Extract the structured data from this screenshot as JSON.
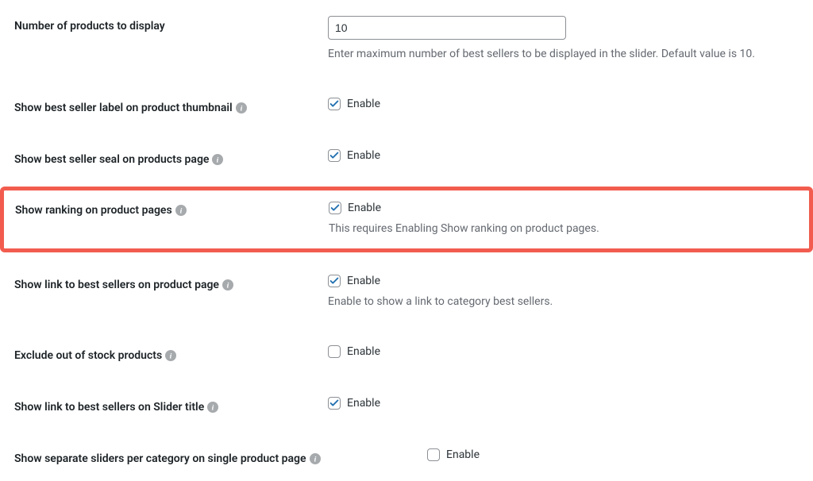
{
  "settings": {
    "numProducts": {
      "label": "Number of products to display",
      "value": "10",
      "description": "Enter maximum number of best sellers to be displayed in the slider. Default value is 10."
    },
    "labelThumbnail": {
      "label": "Show best seller label on product thumbnail",
      "checkboxLabel": "Enable",
      "checked": true
    },
    "sealProductsPage": {
      "label": "Show best seller seal on products page",
      "checkboxLabel": "Enable",
      "checked": true
    },
    "rankingProductPages": {
      "label": "Show ranking on product pages",
      "checkboxLabel": "Enable",
      "checked": true,
      "description": "This requires Enabling Show ranking on product pages."
    },
    "linkProductPage": {
      "label": "Show link to best sellers on product page",
      "checkboxLabel": "Enable",
      "checked": true,
      "description": "Enable to show a link to category best sellers."
    },
    "excludeOutOfStock": {
      "label": "Exclude out of stock products",
      "checkboxLabel": "Enable",
      "checked": false
    },
    "linkSliderTitle": {
      "label": "Show link to best sellers on Slider title",
      "checkboxLabel": "Enable",
      "checked": true
    },
    "separateSliders": {
      "label": "Show separate sliders per category on single product page",
      "checkboxLabel": "Enable",
      "checked": false
    }
  }
}
